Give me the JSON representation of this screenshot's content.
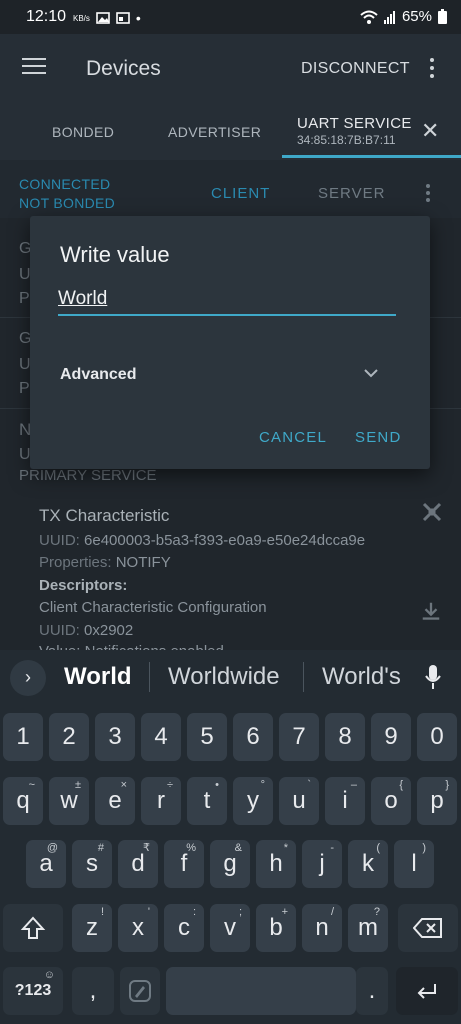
{
  "status_bar": {
    "time": "12:10",
    "net": "KB/s",
    "battery": "65%"
  },
  "app_bar": {
    "title": "Devices",
    "disconnect": "DISCONNECT"
  },
  "tabs": [
    {
      "label": "BONDED"
    },
    {
      "label": "ADVERTISER"
    },
    {
      "label": "UART SERVICE",
      "sub": "34:85:18:7B:B7:11"
    }
  ],
  "subbar": {
    "connected": "CONNECTED",
    "bonded": "NOT BONDED",
    "client": "CLIENT",
    "server": "SERVER"
  },
  "background": {
    "primary_service": "PRIMARY SERVICE",
    "characteristic": {
      "name": "TX Characteristic",
      "uuid_label": "UUID:",
      "uuid": "6e400003-b5a3-f393-e0a9-e50e24dcca9e",
      "props_label": "Properties:",
      "props": "NOTIFY",
      "descriptors": "Descriptors:",
      "desc_name": "Client Characteristic Configuration",
      "desc_uuid": "0x2902",
      "value_line": "Value: Notifications enabled"
    }
  },
  "dialog": {
    "title": "Write value",
    "value": "World",
    "advanced": "Advanced",
    "cancel": "CANCEL",
    "send": "SEND"
  },
  "keyboard": {
    "suggestions": [
      "World",
      "Worldwide",
      "World's"
    ],
    "row_numbers": [
      "1",
      "2",
      "3",
      "4",
      "5",
      "6",
      "7",
      "8",
      "9",
      "0"
    ],
    "row1": [
      "q",
      "w",
      "e",
      "r",
      "t",
      "y",
      "u",
      "i",
      "o",
      "p"
    ],
    "row1_hints": [
      "~",
      "±",
      "×",
      "÷",
      "•",
      "°",
      "`",
      "–",
      "{",
      "}"
    ],
    "row2": [
      "a",
      "s",
      "d",
      "f",
      "g",
      "h",
      "j",
      "k",
      "l"
    ],
    "row2_hints": [
      "@",
      "#",
      "₹",
      "%",
      "&",
      "*",
      "-",
      "(",
      ")"
    ],
    "row3": [
      "z",
      "x",
      "c",
      "v",
      "b",
      "n",
      "m"
    ],
    "row3_hints": [
      "!",
      "'",
      ":",
      ";",
      "+",
      "/",
      "?"
    ],
    "sym": "?123",
    "comma": ",",
    "period": "."
  }
}
